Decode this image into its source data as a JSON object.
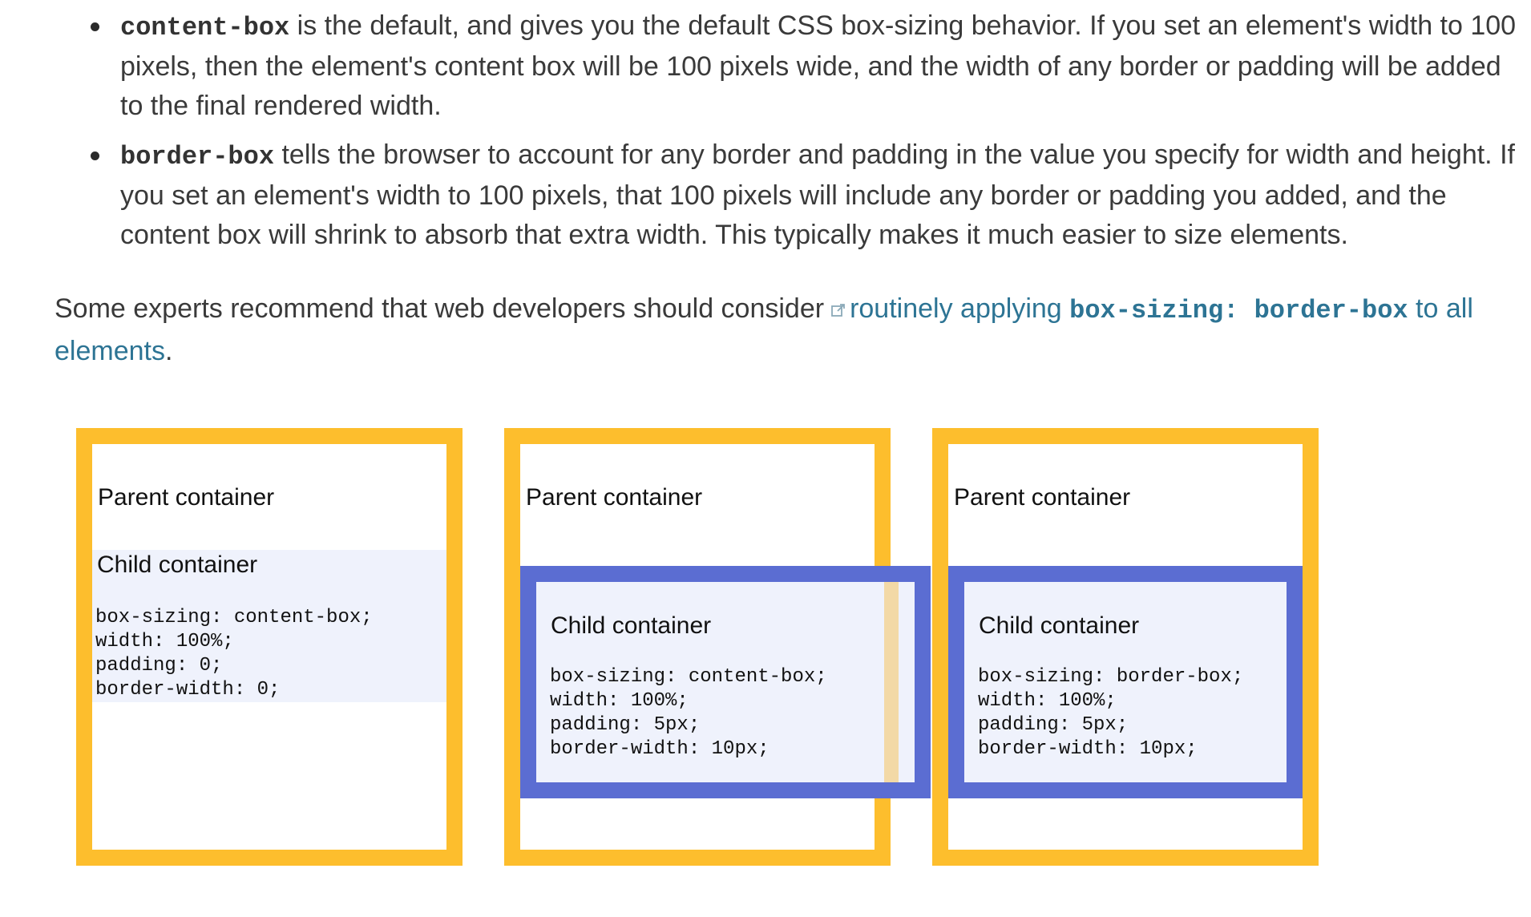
{
  "bullets": [
    {
      "code": "content-box",
      "text": " is the default, and gives you the default CSS box-sizing behavior. If you set an element's width to 100 pixels, then the element's content box will be 100 pixels wide, and the width of any border or padding will be added to the final rendered width."
    },
    {
      "code": "border-box",
      "text": " tells the browser to account for any border and padding in the value you specify for width and height. If you set an element's width to 100 pixels, that 100 pixels will include any border or padding you added, and the content box will shrink to absorb that extra width. This typically makes it much easier to size elements."
    }
  ],
  "paragraph": {
    "before": "Some experts recommend that web developers should consider",
    "link_text_1": "routinely applying ",
    "link_code": "box-sizing: border-box",
    "link_text_2": " to all elements",
    "after": "."
  },
  "diagram": {
    "parent_label": "Parent container",
    "child_label": "Child container",
    "colors": {
      "parent_border": "#fdbe2d",
      "child_border": "#5b6dd2",
      "child_background": "#eff2fc",
      "overflow_highlight": "#f3d9a6"
    },
    "examples": [
      {
        "code": "box-sizing: content-box;\nwidth: 100%;\npadding: 0;\nborder-width: 0;"
      },
      {
        "code": "box-sizing: content-box;\nwidth: 100%;\npadding: 5px;\nborder-width: 10px;"
      },
      {
        "code": "box-sizing: border-box;\nwidth: 100%;\npadding: 5px;\nborder-width: 10px;"
      }
    ]
  }
}
